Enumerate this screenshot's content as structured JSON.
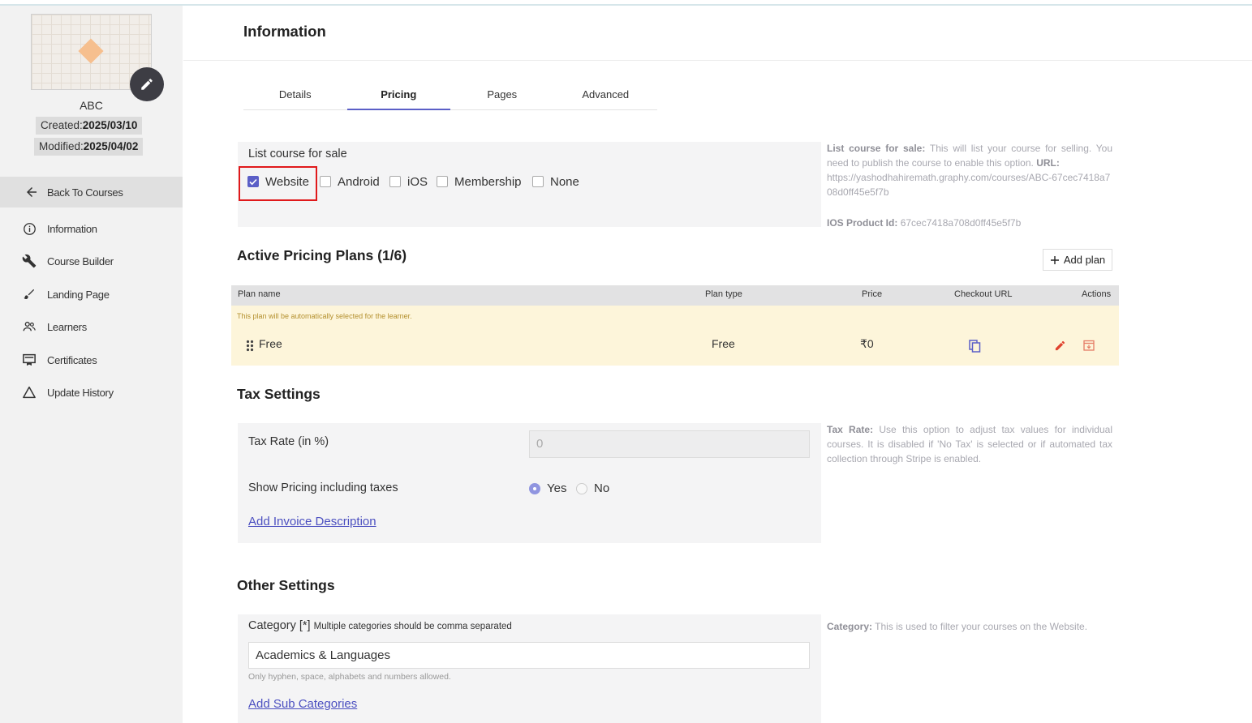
{
  "sidebar": {
    "course_name": "ABC",
    "created_label": "Created:",
    "created_value": "2025/03/10",
    "modified_label": "Modified:",
    "modified_value": "2025/04/02",
    "back_label": "Back To Courses",
    "items": [
      {
        "label": "Information",
        "icon": "info-icon"
      },
      {
        "label": "Course Builder",
        "icon": "wrench-icon"
      },
      {
        "label": "Landing Page",
        "icon": "brush-icon"
      },
      {
        "label": "Learners",
        "icon": "people-icon"
      },
      {
        "label": "Certificates",
        "icon": "certificate-icon"
      },
      {
        "label": "Update History",
        "icon": "triangle-icon"
      }
    ]
  },
  "header": {
    "title": "Information"
  },
  "tabs": [
    {
      "label": "Details",
      "active": false
    },
    {
      "label": "Pricing",
      "active": true
    },
    {
      "label": "Pages",
      "active": false
    },
    {
      "label": "Advanced",
      "active": false
    }
  ],
  "list_for_sale": {
    "label": "List course for sale",
    "options": [
      {
        "label": "Website",
        "checked": true
      },
      {
        "label": "Android",
        "checked": false
      },
      {
        "label": "iOS",
        "checked": false
      },
      {
        "label": "Membership",
        "checked": false
      },
      {
        "label": "None",
        "checked": false
      }
    ],
    "help_title": "List course for sale:",
    "help_text": "This will list your course for selling. You need to publish the course to enable this option.",
    "help_url_label": "URL:",
    "help_url": "https://yashodhahiremath.graphy.com/courses/ABC-67cec7418a708d0ff45e5f7b",
    "ios_label": "IOS Product Id:",
    "ios_value": "67cec7418a708d0ff45e5f7b"
  },
  "pricing_plans": {
    "title": "Active Pricing Plans (1/6)",
    "add_label": "Add plan",
    "columns": [
      "Plan name",
      "Plan type",
      "Price",
      "Checkout URL",
      "Actions"
    ],
    "note": "This plan will be automatically selected for the learner.",
    "rows": [
      {
        "name": "Free",
        "type": "Free",
        "price": "₹0"
      }
    ]
  },
  "tax": {
    "title": "Tax Settings",
    "rate_label": "Tax Rate (in %)",
    "rate_placeholder": "0",
    "show_label": "Show Pricing including taxes",
    "yes_label": "Yes",
    "no_label": "No",
    "selected": "Yes",
    "invoice_link": "Add Invoice Description",
    "help_title": "Tax Rate:",
    "help_text": "Use this option to adjust tax values for individual courses. It is disabled if 'No Tax' is selected or if automated tax collection through Stripe is enabled."
  },
  "other": {
    "title": "Other Settings",
    "category_label": "Category [*]",
    "category_hint": "Multiple categories should be comma separated",
    "category_value": "Academics & Languages",
    "category_note": "Only hyphen, space, alphabets and numbers allowed.",
    "sub_link": "Add Sub Categories",
    "help_title": "Category:",
    "help_text": "This is used to filter your courses on the Website."
  },
  "colors": {
    "accent": "#5b5fc7",
    "highlight_row": "#fdf5da",
    "danger": "#e0432f"
  }
}
